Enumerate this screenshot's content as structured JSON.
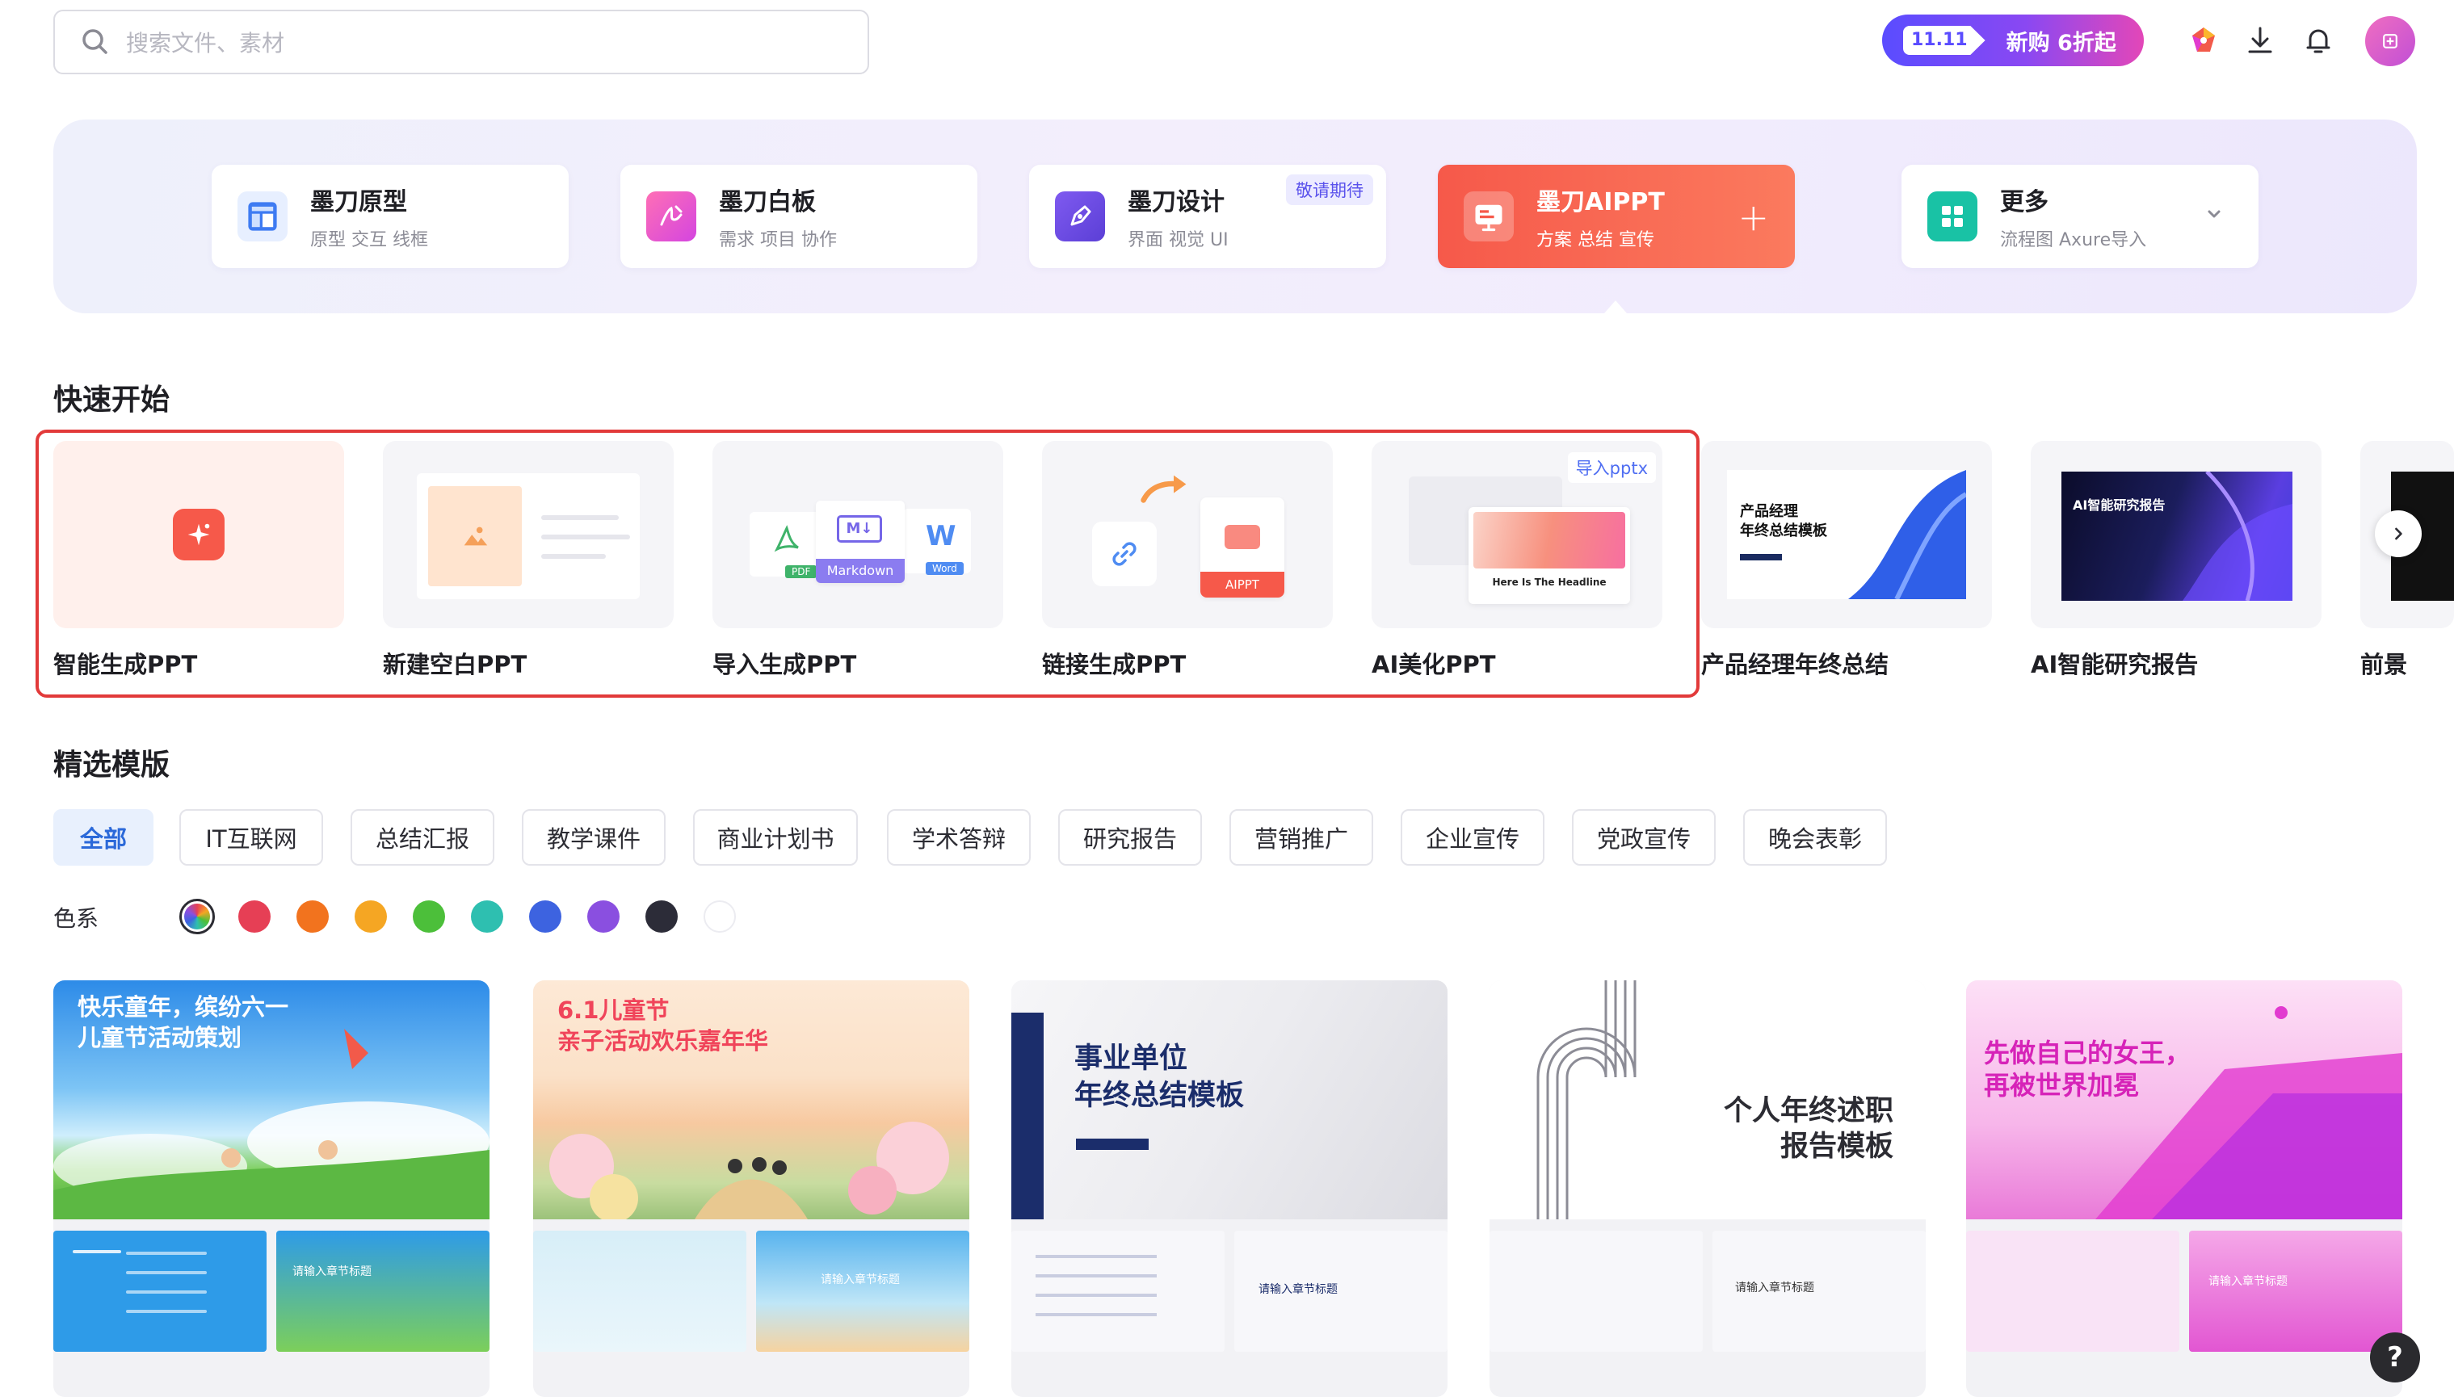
{
  "search": {
    "placeholder": "搜索文件、素材"
  },
  "promo": {
    "tag": "11.11",
    "text": "新购 6折起"
  },
  "products": [
    {
      "name": "墨刀原型",
      "desc": "原型 交互 线框",
      "icon": "prototype-icon"
    },
    {
      "name": "墨刀白板",
      "desc": "需求 项目 协作",
      "icon": "whiteboard-icon"
    },
    {
      "name": "墨刀设计",
      "desc": "界面 视觉 UI",
      "icon": "design-pen-icon",
      "badge": "敬请期待"
    },
    {
      "name": "墨刀AIPPT",
      "desc": "方案 总结 宣传",
      "icon": "aippt-icon",
      "active": true
    },
    {
      "name": "更多",
      "desc": "流程图 Axure导入",
      "icon": "grid-icon"
    }
  ],
  "quick": {
    "title": "快速开始",
    "items": [
      {
        "label": "智能生成PPT"
      },
      {
        "label": "新建空白PPT"
      },
      {
        "label": "导入生成PPT"
      },
      {
        "label": "链接生成PPT"
      },
      {
        "label": "AI美化PPT",
        "badge": "导入pptx"
      },
      {
        "label": "产品经理年终总结"
      },
      {
        "label": "AI智能研究报告"
      },
      {
        "label": "前景"
      }
    ],
    "thumb_text": {
      "markdown": "Markdown",
      "pdf": "PDF",
      "word": "Word",
      "aippt": "AIPPT",
      "headline": "Here Is The Headline",
      "pm_title": "产品经理\n年终总结模板",
      "ai_report_title": "AI智能研究报告"
    }
  },
  "templates": {
    "title": "精选模版",
    "filters": [
      "全部",
      "IT互联网",
      "总结汇报",
      "教学课件",
      "商业计划书",
      "学术答辩",
      "研究报告",
      "营销推广",
      "企业宣传",
      "党政宣传",
      "晚会表彰"
    ],
    "color_label": "色系",
    "colors": [
      "#e63f55",
      "#f2731e",
      "#f5a623",
      "#4cbf3a",
      "#2ebfb0",
      "#3d63e0",
      "#8a4fe0",
      "#2c2c38",
      "#ffffff"
    ],
    "cards": [
      {
        "title": "快乐童年，缤纷六一\n儿童节活动策划",
        "sub": "请输入章节标题"
      },
      {
        "title": "6.1儿童节\n亲子活动欢乐嘉年华",
        "sub": "请输入章节标题"
      },
      {
        "title": "事业单位\n年终总结模板",
        "sub": "请输入章节标题"
      },
      {
        "title": "个人年终述职\n报告模板",
        "sub": "请输入章节标题"
      },
      {
        "title": "先做自己的女王，\n再被世界加冕",
        "sub": "请输入章节标题"
      }
    ]
  },
  "help": {
    "label": "?"
  }
}
